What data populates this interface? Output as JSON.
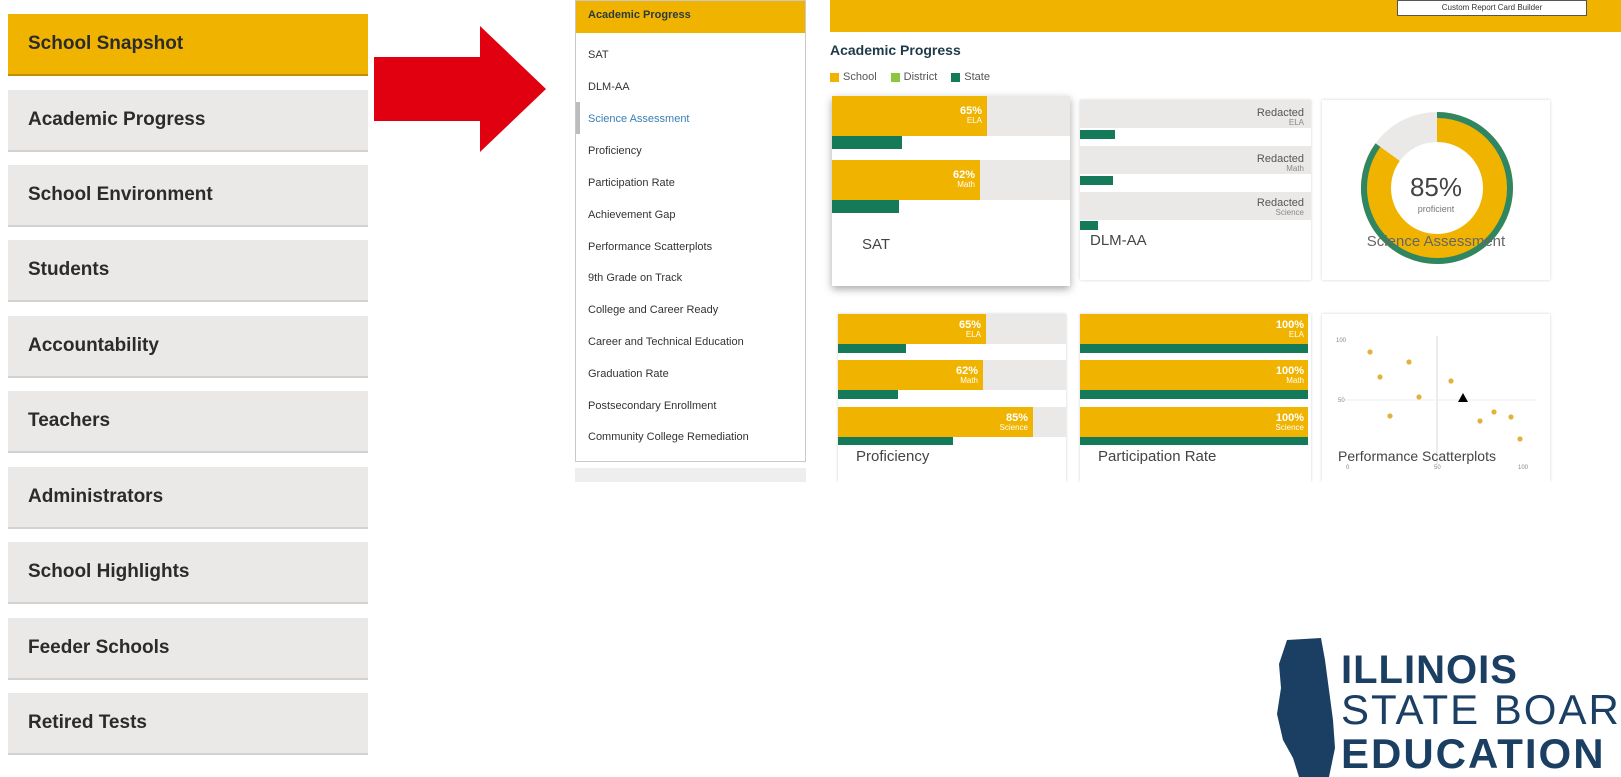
{
  "nav": {
    "items": [
      {
        "label": "School Snapshot",
        "active": true
      },
      {
        "label": "Academic Progress",
        "active": false
      },
      {
        "label": "School Environment",
        "active": false
      },
      {
        "label": "Students",
        "active": false
      },
      {
        "label": "Accountability",
        "active": false
      },
      {
        "label": "Teachers",
        "active": false
      },
      {
        "label": "Administrators",
        "active": false
      },
      {
        "label": "School Highlights",
        "active": false
      },
      {
        "label": "Feeder Schools",
        "active": false
      },
      {
        "label": "Retired Tests",
        "active": false
      }
    ]
  },
  "colors": {
    "accent": "#f0b400",
    "district": "#8cc63e",
    "state": "#157a5a",
    "arrow": "#e0000f",
    "logo": "#1b3f63"
  },
  "submenu": {
    "header": "Academic Progress",
    "items": [
      "SAT",
      "DLM-AA",
      "Science Assessment",
      "Proficiency",
      "Participation Rate",
      "Achievement Gap",
      "Performance Scatterplots",
      "9th Grade on Track",
      "College and Career Ready",
      "Career and Technical Education",
      "Graduation Rate",
      "Postsecondary Enrollment",
      "Community College Remediation"
    ],
    "current": "Science Assessment"
  },
  "topbar": {
    "button_label": "Custom Report Card Builder"
  },
  "main": {
    "title": "Academic Progress",
    "legend": [
      "School",
      "District",
      "State"
    ]
  },
  "cards": {
    "sat": {
      "title": "SAT",
      "bars": [
        {
          "value": "65%",
          "sub": "ELA"
        },
        {
          "value": "62%",
          "sub": "Math"
        }
      ]
    },
    "dlm": {
      "title": "DLM-AA",
      "bars": [
        {
          "value": "Redacted",
          "sub": "ELA"
        },
        {
          "value": "Redacted",
          "sub": "Math"
        },
        {
          "value": "Redacted",
          "sub": "Science"
        }
      ]
    },
    "science": {
      "title": "Science Assessment",
      "value": "85%",
      "sub": "proficient",
      "fraction": 0.85
    },
    "proficiency": {
      "title": "Proficiency",
      "bars": [
        {
          "value": "65%",
          "sub": "ELA"
        },
        {
          "value": "62%",
          "sub": "Math"
        },
        {
          "value": "85%",
          "sub": "Science"
        }
      ]
    },
    "participation": {
      "title": "Participation Rate",
      "bars": [
        {
          "value": "100%",
          "sub": "ELA"
        },
        {
          "value": "100%",
          "sub": "Math"
        },
        {
          "value": "100%",
          "sub": "Science"
        }
      ]
    },
    "scatter": {
      "title": "Performance Scatterplots",
      "y_ticks": [
        "100",
        "50"
      ],
      "x_ticks": [
        "0",
        "50",
        "100"
      ]
    }
  },
  "logo": {
    "line1": "ILLINOIS",
    "line2": "STATE BOARD",
    "line3": "EDUCATION"
  }
}
